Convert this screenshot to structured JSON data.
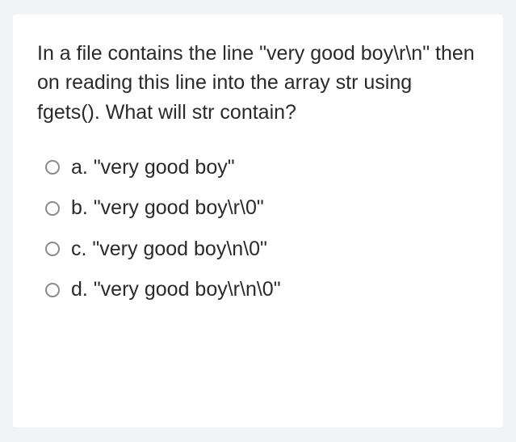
{
  "question": "In a file contains the line \"very good boy\\r\\n\" then on reading this line into the array str using fgets(). What will str contain?",
  "options": [
    {
      "letter": "a.",
      "text": "\"very good boy\""
    },
    {
      "letter": "b.",
      "text": "\"very good boy\\r\\0\""
    },
    {
      "letter": "c.",
      "text": "\"very good boy\\n\\0\""
    },
    {
      "letter": "d.",
      "text": "\"very good boy\\r\\n\\0\""
    }
  ]
}
